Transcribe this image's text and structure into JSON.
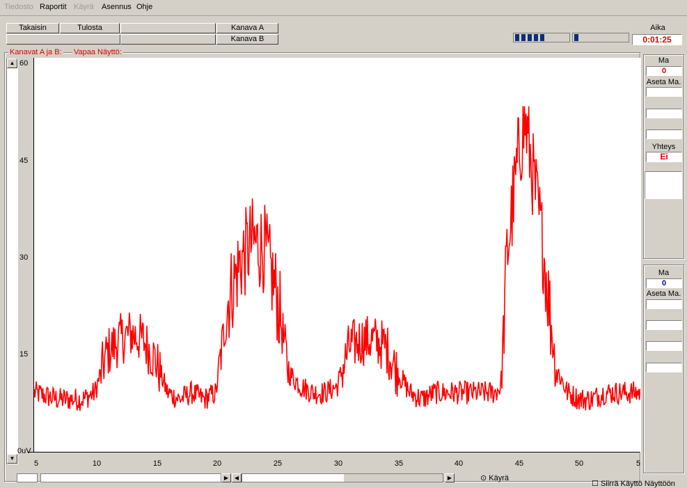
{
  "menu": [
    "Tiedosto",
    "Raportit",
    "Käyrä",
    "Asennus",
    "Ohje"
  ],
  "menu_disabled": [
    true,
    false,
    true,
    false,
    false
  ],
  "toolbar": {
    "back_label": "Takaisin",
    "print_label": "Tulosta",
    "channel_a_label": "Kanava A",
    "channel_b_label": "Kanava B"
  },
  "time": {
    "label": "Aika",
    "value": "0:01:25"
  },
  "chart_header": {
    "channels_label": "Kanavat A ja B:",
    "mode_label": "Vapaa Näyttö:"
  },
  "panel_a": {
    "ma_label": "Ma",
    "ma_value": "0",
    "aseta_label": "Aseta Ma.",
    "connection_label": "Yhteys",
    "connection_value": "Ei"
  },
  "panel_b": {
    "ma_label": "Ma",
    "ma_value": "0",
    "aseta_label": "Aseta Ma."
  },
  "bottom": {
    "radio_label": "Käyrä",
    "checkbox_label": "Siirrä Käyttö Näyttöön"
  },
  "colors": {
    "trace": "#ff0000",
    "accent_red": "#e00000",
    "accent_blue": "#0000c0"
  },
  "chart_data": {
    "type": "line",
    "y_tick_labels": [
      "60",
      "45",
      "30",
      "15",
      "0uV"
    ],
    "x_tick_labels": [
      "5",
      "10",
      "15",
      "20",
      "25",
      "30",
      "35",
      "40",
      "45",
      "50",
      "5"
    ],
    "xlim": [
      5,
      55
    ],
    "ylim": [
      0,
      60
    ],
    "series": [
      {
        "x": [
          5,
          7,
          9,
          10,
          11,
          12,
          13,
          14,
          15,
          16,
          17,
          18,
          19,
          20,
          21,
          22,
          23,
          24,
          25,
          26,
          27,
          28,
          29,
          30,
          31,
          32,
          33,
          34,
          35,
          36,
          37,
          38,
          39,
          40,
          41,
          42,
          43,
          43.5,
          44,
          45,
          45.5,
          46,
          47,
          48,
          49,
          50,
          51,
          52,
          53,
          54,
          55
        ],
        "values": [
          9,
          8,
          8,
          9,
          15,
          17,
          18,
          17,
          14,
          9,
          8,
          9,
          8,
          9,
          23,
          29,
          32,
          31,
          24,
          12,
          10,
          9,
          9,
          10,
          16,
          17,
          17,
          16,
          12,
          9,
          8,
          9,
          9,
          9,
          9,
          9,
          9,
          10,
          30,
          46,
          50,
          44,
          31,
          13,
          9,
          8,
          8,
          9,
          9,
          9,
          9
        ]
      }
    ]
  }
}
